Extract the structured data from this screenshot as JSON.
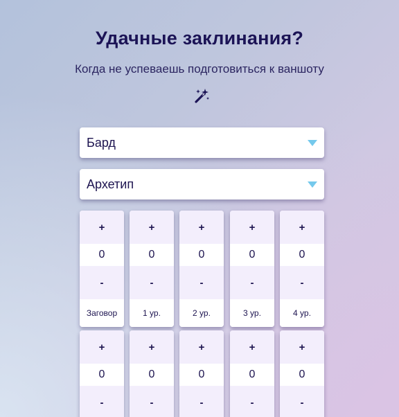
{
  "header": {
    "title": "Удачные заклинания?",
    "subtitle": "Когда не успеваешь подготовиться к ваншоту",
    "icon": "magic-wand-icon"
  },
  "selects": {
    "class_value": "Бард",
    "archetype_value": "Архетип"
  },
  "counters_row1": [
    {
      "plus": "+",
      "value": "0",
      "minus": "-",
      "label": "Заговор"
    },
    {
      "plus": "+",
      "value": "0",
      "minus": "-",
      "label": "1 ур."
    },
    {
      "plus": "+",
      "value": "0",
      "minus": "-",
      "label": "2 ур."
    },
    {
      "plus": "+",
      "value": "0",
      "minus": "-",
      "label": "3 ур."
    },
    {
      "plus": "+",
      "value": "0",
      "minus": "-",
      "label": "4 ур."
    }
  ],
  "counters_row2": [
    {
      "plus": "+",
      "value": "0",
      "minus": "-"
    },
    {
      "plus": "+",
      "value": "0",
      "minus": "-"
    },
    {
      "plus": "+",
      "value": "0",
      "minus": "-"
    },
    {
      "plus": "+",
      "value": "0",
      "minus": "-"
    },
    {
      "plus": "+",
      "value": "0",
      "minus": "-"
    }
  ],
  "colors": {
    "title": "#1c1456",
    "caret": "#75c9ec",
    "button_bg": "#f3eefc"
  }
}
